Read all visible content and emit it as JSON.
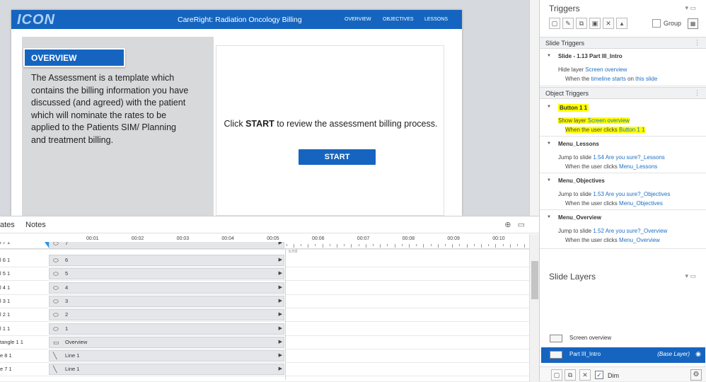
{
  "slide": {
    "logo": "ICON",
    "course_title": "CareRight: Radiation Oncology Billing",
    "nav": [
      "OVERVIEW",
      "OBJECTIVES",
      "LESSONS"
    ],
    "overview_heading": "OVERVIEW",
    "overview_body": "The Assessment is a template which contains the billing information you have discussed (and agreed) with the patient which will nominate the rates to be applied to the Patients SIM/ Planning and treatment billing.",
    "click_prefix": "Click ",
    "click_bold": "START",
    "click_suffix": " to review the assessment billing process.",
    "start_button": "START"
  },
  "timeline": {
    "tabs": [
      "ates",
      "Notes"
    ],
    "ticks": [
      "00:01",
      "00:02",
      "00:03",
      "00:04",
      "00:05",
      "00:06",
      "00:07",
      "00:08",
      "00:09",
      "00:10"
    ],
    "end_label": "End",
    "rows": [
      {
        "name": "l 7 1",
        "bar": "7",
        "icon": "oval-icon"
      },
      {
        "name": "l 6 1",
        "bar": "6",
        "icon": "oval-icon"
      },
      {
        "name": "l 5 1",
        "bar": "5",
        "icon": "oval-icon"
      },
      {
        "name": "l 4 1",
        "bar": "4",
        "icon": "oval-icon"
      },
      {
        "name": "l 3 1",
        "bar": "3",
        "icon": "oval-icon"
      },
      {
        "name": "l 2 1",
        "bar": "2",
        "icon": "oval-icon"
      },
      {
        "name": "l 1 1",
        "bar": "1",
        "icon": "oval-icon"
      },
      {
        "name": "tangle 1 1",
        "bar": "Overview",
        "icon": "rectangle-icon"
      },
      {
        "name": "e 8 1",
        "bar": "Line 1",
        "icon": "line-icon"
      },
      {
        "name": "e 7 1",
        "bar": "Line 1",
        "icon": "line-icon"
      }
    ]
  },
  "triggers": {
    "title": "Triggers",
    "group_label": "Group",
    "slide_triggers_header": "Slide Triggers",
    "slide_name": "Slide - 1.13 Part III_Intro",
    "slide_action_prefix": "Hide layer ",
    "slide_action_target": "Screen overview",
    "slide_when_prefix": "When the ",
    "slide_when_event": "timeline starts",
    "slide_when_mid": " on ",
    "slide_when_object": "this slide",
    "object_triggers_header": "Object Triggers",
    "items": [
      {
        "name": "Button 1 1",
        "action_prefix": "Show layer ",
        "action_target": "Screen overview",
        "when_prefix": "When the user clicks ",
        "when_object": "Button 1 1"
      },
      {
        "name": "Menu_Lessons",
        "action_prefix": "Jump to slide ",
        "action_target": "1.54 Are you sure?_Lessons",
        "when_prefix": "When the user clicks ",
        "when_object": "Menu_Lessons"
      },
      {
        "name": "Menu_Objectives",
        "action_prefix": "Jump to slide ",
        "action_target": "1.53 Are you sure?_Objectives",
        "when_prefix": "When the user clicks ",
        "when_object": "Menu_Objectives"
      },
      {
        "name": "Menu_Overview",
        "action_prefix": "Jump to slide ",
        "action_target": "1.52 Are you sure?_Overview",
        "when_prefix": "When the user clicks ",
        "when_object": "Menu_Overview"
      }
    ]
  },
  "layers": {
    "title": "Slide Layers",
    "items": [
      {
        "name": "Screen overview",
        "tag": ""
      },
      {
        "name": "Part III_Intro",
        "tag": "(Base Layer)"
      }
    ],
    "dim_label": "Dim",
    "dim_checked": true
  },
  "colors": {
    "brand_blue": "#1565c0",
    "highlight": "#ffff00",
    "link": "#1e6fc4"
  }
}
